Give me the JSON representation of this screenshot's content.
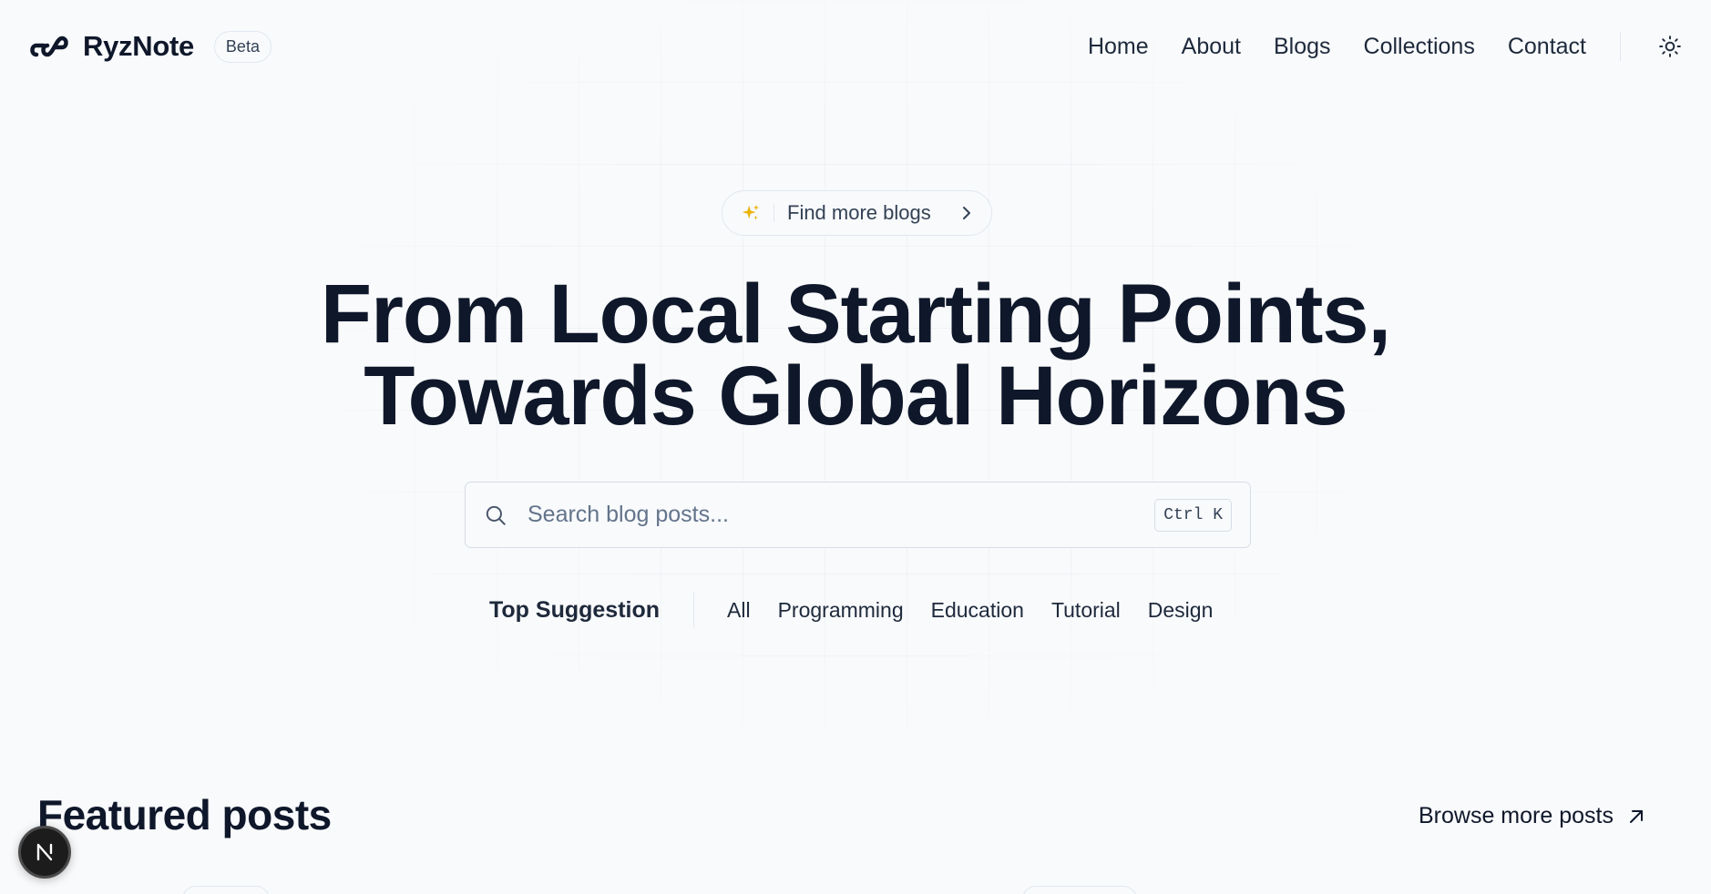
{
  "brand": {
    "name": "RyzNote",
    "badge": "Beta"
  },
  "nav": {
    "items": [
      {
        "label": "Home"
      },
      {
        "label": "About"
      },
      {
        "label": "Blogs"
      },
      {
        "label": "Collections"
      },
      {
        "label": "Contact"
      }
    ],
    "theme_icon": "sun-icon"
  },
  "hero": {
    "pill": {
      "label": "Find more blogs",
      "icon": "sparkles-icon"
    },
    "headline": {
      "line1": "From Local Starting Points,",
      "line2": "Towards Global Horizons"
    },
    "search": {
      "placeholder": "Search blog posts...",
      "value": "",
      "shortcut": "Ctrl K"
    },
    "suggestions": {
      "title": "Top Suggestion",
      "tags": [
        {
          "label": "All"
        },
        {
          "label": "Programming"
        },
        {
          "label": "Education"
        },
        {
          "label": "Tutorial"
        },
        {
          "label": "Design"
        }
      ]
    }
  },
  "featured": {
    "title": "Featured posts",
    "browse_label": "Browse more posts"
  },
  "dev_badge": {
    "letter": "N"
  },
  "colors": {
    "background": "#f8fafc",
    "text": "#0f172a",
    "border": "#e2e8f0",
    "accent_sparkle": "#eab308"
  }
}
